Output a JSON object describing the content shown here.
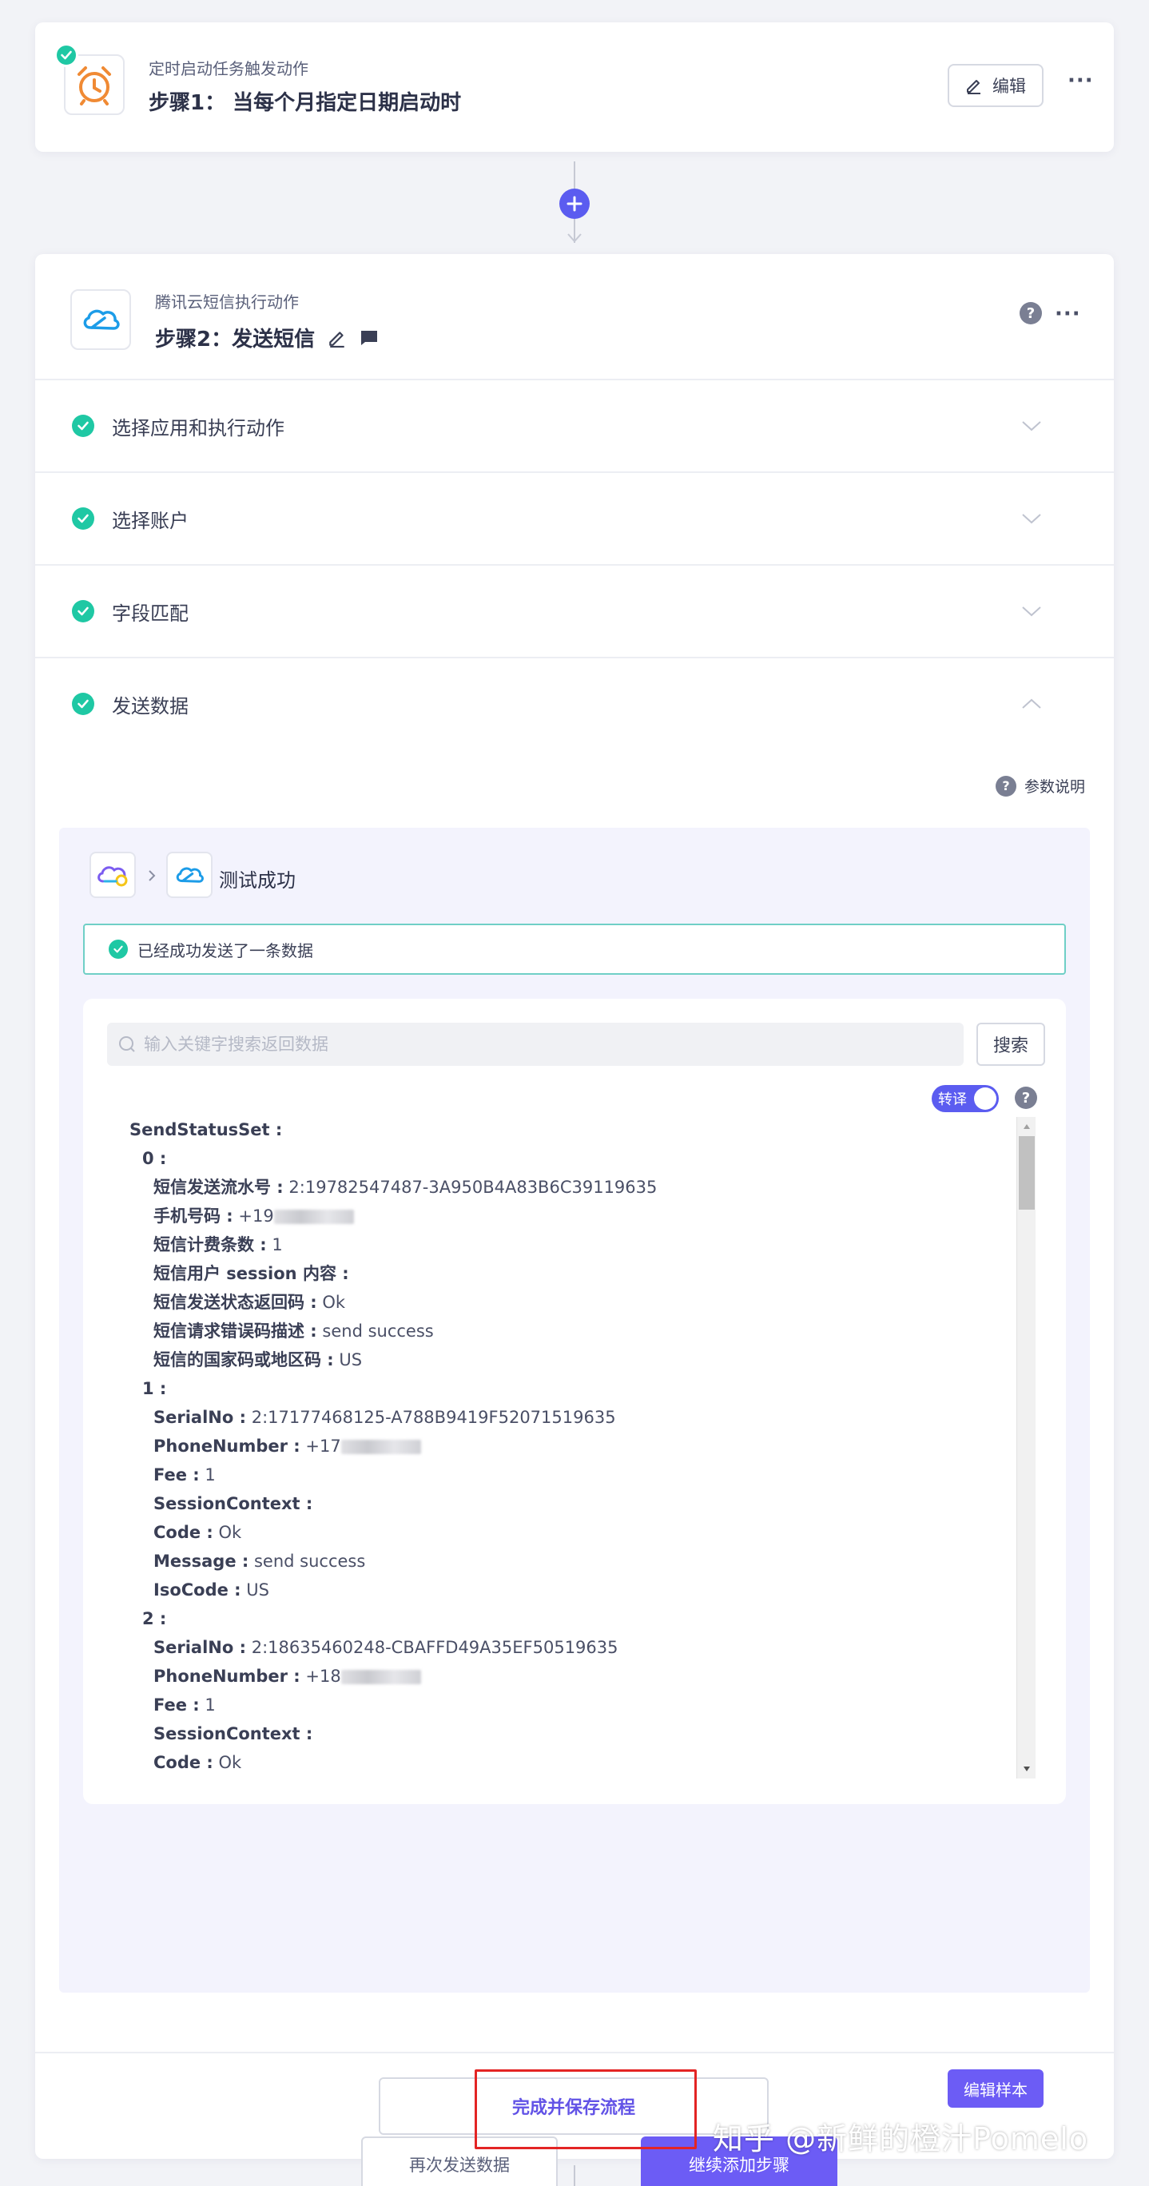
{
  "step1": {
    "subtitle": "定时启动任务触发动作",
    "title": "步骤1： 当每个月指定日期启动时",
    "edit_label": "编辑",
    "more": "···"
  },
  "step2": {
    "subtitle": "腾讯云短信执行动作",
    "title": "步骤2：发送短信",
    "help": "?",
    "more": "···",
    "sections": [
      {
        "label": "选择应用和执行动作",
        "expanded": false
      },
      {
        "label": "选择账户",
        "expanded": false
      },
      {
        "label": "字段匹配",
        "expanded": false
      },
      {
        "label": "发送数据",
        "expanded": true
      }
    ],
    "param_help": "参数说明",
    "test": {
      "title": "测试成功",
      "success_message": "已经成功发送了一条数据",
      "search_placeholder": "输入关键字搜索返回数据",
      "search_label": "搜索",
      "toggle_label": "转译",
      "toggle_on": true,
      "tree": [
        {
          "indent": 0,
          "key": "SendStatusSet :",
          "value": ""
        },
        {
          "indent": 1,
          "key": "0 :",
          "value": ""
        },
        {
          "indent": 2,
          "key": "短信发送流水号 :",
          "value": "2:19782547487-3A950B4A83B6C39119635"
        },
        {
          "indent": 2,
          "key": "手机号码 :",
          "value": "+19",
          "redacted": true
        },
        {
          "indent": 2,
          "key": "短信计费条数 :",
          "value": "1"
        },
        {
          "indent": 2,
          "key": "短信用户 session 内容 :",
          "value": ""
        },
        {
          "indent": 2,
          "key": "短信发送状态返回码 :",
          "value": "Ok"
        },
        {
          "indent": 2,
          "key": "短信请求错误码描述 :",
          "value": "send success"
        },
        {
          "indent": 2,
          "key": "短信的国家码或地区码 :",
          "value": "US"
        },
        {
          "indent": 1,
          "key": "1 :",
          "value": ""
        },
        {
          "indent": 2,
          "key": "SerialNo :",
          "value": "2:17177468125-A788B9419F52071519635"
        },
        {
          "indent": 2,
          "key": "PhoneNumber :",
          "value": "+17",
          "redacted": true
        },
        {
          "indent": 2,
          "key": "Fee :",
          "value": "1"
        },
        {
          "indent": 2,
          "key": "SessionContext :",
          "value": ""
        },
        {
          "indent": 2,
          "key": "Code :",
          "value": "Ok"
        },
        {
          "indent": 2,
          "key": "Message :",
          "value": "send success"
        },
        {
          "indent": 2,
          "key": "IsoCode :",
          "value": "US"
        },
        {
          "indent": 1,
          "key": "2 :",
          "value": ""
        },
        {
          "indent": 2,
          "key": "SerialNo :",
          "value": "2:18635460248-CBAFFD49A35EF50519635"
        },
        {
          "indent": 2,
          "key": "PhoneNumber :",
          "value": "+18",
          "redacted": true
        },
        {
          "indent": 2,
          "key": "Fee :",
          "value": "1"
        },
        {
          "indent": 2,
          "key": "SessionContext :",
          "value": ""
        },
        {
          "indent": 2,
          "key": "Code :",
          "value": "Ok"
        }
      ],
      "edit_sample_label": "编辑样本",
      "resend_label": "再次发送数据",
      "continue_label": "继续添加步骤"
    },
    "save_label": "完成并保存流程"
  },
  "watermark": "知乎 @新鲜的橙汁Pomelo",
  "colors": {
    "accent": "#6c5cf5",
    "success": "#1fc8a4",
    "highlight": "#e32424",
    "alarm": "#f08a34"
  }
}
